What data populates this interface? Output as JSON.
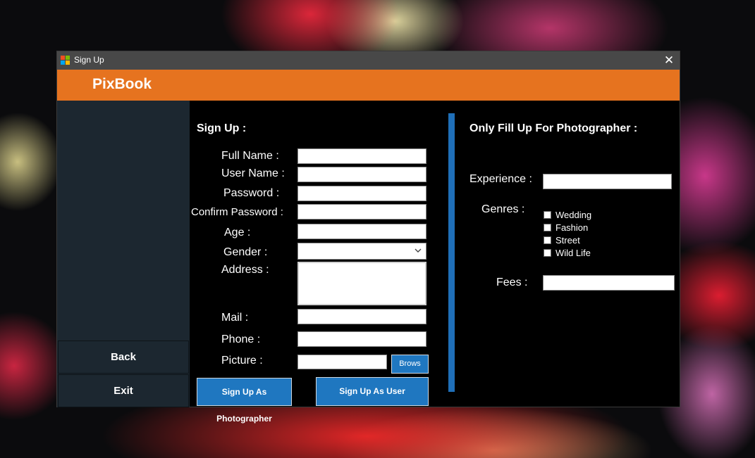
{
  "window": {
    "title": "Sign Up",
    "close_symbol": "✕"
  },
  "banner": {
    "brand": "PixBook",
    "color": "#e6731f"
  },
  "sidebar": {
    "back_label": "Back",
    "exit_label": "Exit"
  },
  "signup": {
    "heading": "Sign Up :",
    "labels": {
      "full_name": "Full Name :",
      "user_name": "User Name :",
      "password": "Password :",
      "confirm_password": "Confirm Password :",
      "age": "Age :",
      "gender": "Gender :",
      "address": "Address :",
      "mail": "Mail :",
      "phone": "Phone :",
      "picture": "Picture :"
    },
    "values": {
      "full_name": "",
      "user_name": "",
      "password": "",
      "confirm_password": "",
      "age": "",
      "gender": "",
      "address": "",
      "mail": "",
      "phone": "",
      "picture": ""
    },
    "browse_label": "Brows",
    "photographer_button": "Sign Up As Photographer",
    "user_button": "Sign Up As User"
  },
  "photographer": {
    "heading": "Only Fill Up For Photographer :",
    "experience_label": "Experience :",
    "experience_value": "",
    "genres_label": "Genres :",
    "genres": [
      {
        "label": "Wedding",
        "checked": false
      },
      {
        "label": "Fashion",
        "checked": false
      },
      {
        "label": "Street",
        "checked": false
      },
      {
        "label": "Wild Life",
        "checked": false
      }
    ],
    "fees_label": "Fees :",
    "fees_value": ""
  },
  "colors": {
    "accent_blue": "#1f77c0",
    "sidebar_bg": "#1c2730",
    "divider": "#1f6fb8"
  }
}
